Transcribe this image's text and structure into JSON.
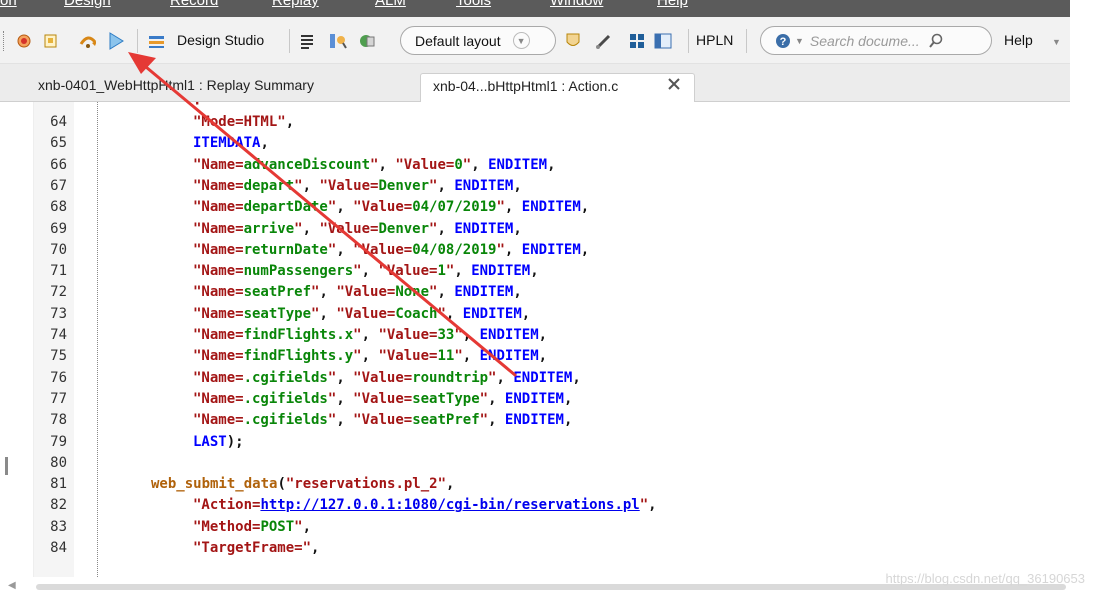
{
  "menu": {
    "items": [
      "on",
      "Design",
      "Record",
      "Replay",
      "ALM",
      "Tools",
      "Window",
      "Help"
    ]
  },
  "toolbar": {
    "record_icon": "record-icon",
    "design_studio_label": "Design Studio",
    "layout_value": "Default layout",
    "hpln_label": "HPLN",
    "search_placeholder": "Search docume...",
    "help_label": "Help"
  },
  "tabs": [
    {
      "label": "xnb-0401_WebHttpHtml1 : Replay Summary"
    },
    {
      "label": "xnb-04...bHttpHtml1 : Action.c"
    }
  ],
  "editor": {
    "lines": [
      {
        "n": "64",
        "t": [
          [
            "s",
            "\"Mode=HTML\""
          ],
          [
            "p",
            ","
          ]
        ]
      },
      {
        "n": "65",
        "t": [
          [
            "k",
            "ITEMDATA"
          ],
          [
            "p",
            ","
          ]
        ]
      },
      {
        "n": "66",
        "t": [
          [
            "s",
            "\"Name="
          ],
          [
            "sv",
            "advanceDiscount"
          ],
          [
            "s",
            "\""
          ],
          [
            "p",
            ", "
          ],
          [
            "s",
            "\"Value="
          ],
          [
            "sv",
            "0"
          ],
          [
            "s",
            "\""
          ],
          [
            "p",
            ", "
          ],
          [
            "k",
            "ENDITEM"
          ],
          [
            "p",
            ","
          ]
        ]
      },
      {
        "n": "67",
        "t": [
          [
            "s",
            "\"Name="
          ],
          [
            "sv",
            "depart"
          ],
          [
            "s",
            "\""
          ],
          [
            "p",
            ", "
          ],
          [
            "s",
            "\"Value="
          ],
          [
            "sv",
            "Denver"
          ],
          [
            "s",
            "\""
          ],
          [
            "p",
            ", "
          ],
          [
            "k",
            "ENDITEM"
          ],
          [
            "p",
            ","
          ]
        ]
      },
      {
        "n": "68",
        "t": [
          [
            "s",
            "\"Name="
          ],
          [
            "sv",
            "departDate"
          ],
          [
            "s",
            "\""
          ],
          [
            "p",
            ", "
          ],
          [
            "s",
            "\"Value="
          ],
          [
            "sv",
            "04/07/2019"
          ],
          [
            "s",
            "\""
          ],
          [
            "p",
            ", "
          ],
          [
            "k",
            "ENDITEM"
          ],
          [
            "p",
            ","
          ]
        ]
      },
      {
        "n": "69",
        "t": [
          [
            "s",
            "\"Name="
          ],
          [
            "sv",
            "arrive"
          ],
          [
            "s",
            "\""
          ],
          [
            "p",
            ", "
          ],
          [
            "s",
            "\"Value="
          ],
          [
            "sv",
            "Denver"
          ],
          [
            "s",
            "\""
          ],
          [
            "p",
            ", "
          ],
          [
            "k",
            "ENDITEM"
          ],
          [
            "p",
            ","
          ]
        ]
      },
      {
        "n": "70",
        "t": [
          [
            "s",
            "\"Name="
          ],
          [
            "sv",
            "returnDate"
          ],
          [
            "s",
            "\""
          ],
          [
            "p",
            ", "
          ],
          [
            "s",
            "\"Value="
          ],
          [
            "sv",
            "04/08/2019"
          ],
          [
            "s",
            "\""
          ],
          [
            "p",
            ", "
          ],
          [
            "k",
            "ENDITEM"
          ],
          [
            "p",
            ","
          ]
        ]
      },
      {
        "n": "71",
        "t": [
          [
            "s",
            "\"Name="
          ],
          [
            "sv",
            "numPassengers"
          ],
          [
            "s",
            "\""
          ],
          [
            "p",
            ", "
          ],
          [
            "s",
            "\"Value="
          ],
          [
            "sv",
            "1"
          ],
          [
            "s",
            "\""
          ],
          [
            "p",
            ", "
          ],
          [
            "k",
            "ENDITEM"
          ],
          [
            "p",
            ","
          ]
        ]
      },
      {
        "n": "72",
        "t": [
          [
            "s",
            "\"Name="
          ],
          [
            "sv",
            "seatPref"
          ],
          [
            "s",
            "\""
          ],
          [
            "p",
            ", "
          ],
          [
            "s",
            "\"Value="
          ],
          [
            "sv",
            "None"
          ],
          [
            "s",
            "\""
          ],
          [
            "p",
            ", "
          ],
          [
            "k",
            "ENDITEM"
          ],
          [
            "p",
            ","
          ]
        ]
      },
      {
        "n": "73",
        "t": [
          [
            "s",
            "\"Name="
          ],
          [
            "sv",
            "seatType"
          ],
          [
            "s",
            "\""
          ],
          [
            "p",
            ", "
          ],
          [
            "s",
            "\"Value="
          ],
          [
            "sv",
            "Coach"
          ],
          [
            "s",
            "\""
          ],
          [
            "p",
            ", "
          ],
          [
            "k",
            "ENDITEM"
          ],
          [
            "p",
            ","
          ]
        ]
      },
      {
        "n": "74",
        "t": [
          [
            "s",
            "\"Name="
          ],
          [
            "sv",
            "findFlights.x"
          ],
          [
            "s",
            "\""
          ],
          [
            "p",
            ", "
          ],
          [
            "s",
            "\"Value="
          ],
          [
            "sv",
            "33"
          ],
          [
            "s",
            "\""
          ],
          [
            "p",
            ", "
          ],
          [
            "k",
            "ENDITEM"
          ],
          [
            "p",
            ","
          ]
        ]
      },
      {
        "n": "75",
        "t": [
          [
            "s",
            "\"Name="
          ],
          [
            "sv",
            "findFlights.y"
          ],
          [
            "s",
            "\""
          ],
          [
            "p",
            ", "
          ],
          [
            "s",
            "\"Value="
          ],
          [
            "sv",
            "11"
          ],
          [
            "s",
            "\""
          ],
          [
            "p",
            ", "
          ],
          [
            "k",
            "ENDITEM"
          ],
          [
            "p",
            ","
          ]
        ]
      },
      {
        "n": "76",
        "t": [
          [
            "s",
            "\"Name="
          ],
          [
            "sv",
            ".cgifields"
          ],
          [
            "s",
            "\""
          ],
          [
            "p",
            ", "
          ],
          [
            "s",
            "\"Value="
          ],
          [
            "sv",
            "roundtrip"
          ],
          [
            "s",
            "\""
          ],
          [
            "p",
            ", "
          ],
          [
            "k",
            "ENDITEM"
          ],
          [
            "p",
            ","
          ]
        ]
      },
      {
        "n": "77",
        "t": [
          [
            "s",
            "\"Name="
          ],
          [
            "sv",
            ".cgifields"
          ],
          [
            "s",
            "\""
          ],
          [
            "p",
            ", "
          ],
          [
            "s",
            "\"Value="
          ],
          [
            "sv",
            "seatType"
          ],
          [
            "s",
            "\""
          ],
          [
            "p",
            ", "
          ],
          [
            "k",
            "ENDITEM"
          ],
          [
            "p",
            ","
          ]
        ]
      },
      {
        "n": "78",
        "t": [
          [
            "s",
            "\"Name="
          ],
          [
            "sv",
            ".cgifields"
          ],
          [
            "s",
            "\""
          ],
          [
            "p",
            ", "
          ],
          [
            "s",
            "\"Value="
          ],
          [
            "sv",
            "seatPref"
          ],
          [
            "s",
            "\""
          ],
          [
            "p",
            ", "
          ],
          [
            "k",
            "ENDITEM"
          ],
          [
            "p",
            ","
          ]
        ]
      },
      {
        "n": "79",
        "t": [
          [
            "k",
            "LAST"
          ],
          [
            "p",
            ");"
          ]
        ]
      },
      {
        "n": "80",
        "t": []
      },
      {
        "n": "81",
        "t": [
          [
            "fn",
            "web_submit_data"
          ],
          [
            "p",
            "("
          ],
          [
            "s",
            "\"reservations.pl_2\""
          ],
          [
            "p",
            ","
          ]
        ],
        "outdent": true
      },
      {
        "n": "82",
        "t": [
          [
            "s",
            "\"Action="
          ],
          [
            "lnk",
            "http://127.0.0.1:1080/cgi-bin/reservations.pl"
          ],
          [
            "s",
            "\""
          ],
          [
            "p",
            ","
          ]
        ]
      },
      {
        "n": "83",
        "t": [
          [
            "s",
            "\"Method="
          ],
          [
            "sv",
            "POST"
          ],
          [
            "s",
            "\""
          ],
          [
            "p",
            ","
          ]
        ]
      },
      {
        "n": "84",
        "t": [
          [
            "s",
            "\"TargetFrame="
          ],
          [
            "s",
            "\""
          ],
          [
            "p",
            ","
          ]
        ]
      }
    ]
  },
  "watermark": "https://blog.csdn.net/qq_36190653",
  "colors": {
    "string": "#a31515",
    "value": "#098609",
    "keyword": "#0000ff",
    "function": "#b0620b",
    "annotation_arrow": "#e53935"
  }
}
